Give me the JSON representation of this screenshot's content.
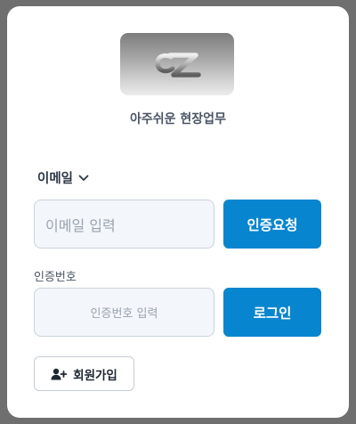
{
  "brand": {
    "subtitle": "아주쉬운 현장업무"
  },
  "login": {
    "method_label": "이메일",
    "email_placeholder": "이메일 입력",
    "request_button": "인증요청",
    "code_label": "인증번호",
    "code_placeholder": "인증번호 입력",
    "login_button": "로그인",
    "signup_button": "회원가입"
  },
  "colors": {
    "primary": "#0885cf",
    "input_bg": "#f3f6fa",
    "input_border": "#c9d3de",
    "text_dark": "#2e3747"
  },
  "icons": {
    "method_dropdown": "chevron-down-icon",
    "signup": "user-plus-icon"
  }
}
